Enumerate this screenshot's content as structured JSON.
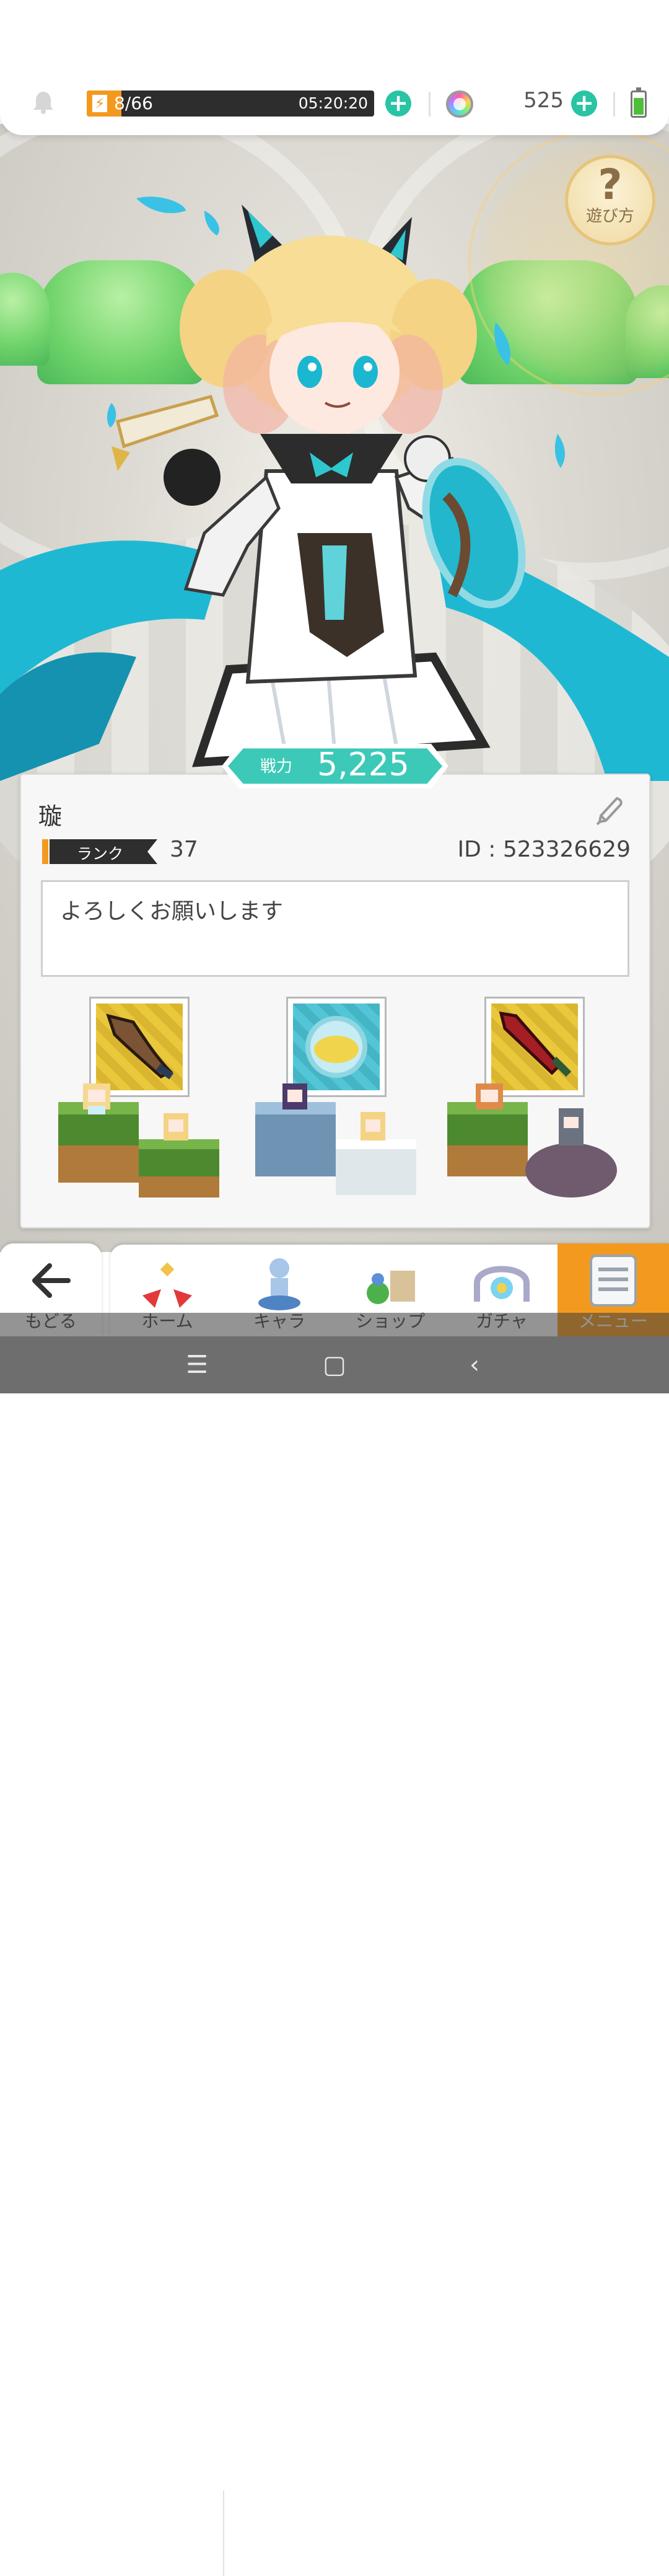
{
  "status": {
    "stamina_current": "8",
    "stamina_max": "/66",
    "stamina_fraction": 0.12,
    "stamina_timer": "05:20:20",
    "gems": "525",
    "plus": "+"
  },
  "help": {
    "label": "遊び方",
    "symbol": "?"
  },
  "power": {
    "label": "戦力",
    "value": "5,225"
  },
  "profile": {
    "name": "璇",
    "rank_label": "ランク",
    "rank_value": "37",
    "id_text": "ID : 523326629",
    "comment": "よろしくお願いします"
  },
  "nav": {
    "back": "もどる",
    "home": "ホーム",
    "chara": "キャラ",
    "shop": "ショップ",
    "gacha": "ガチャ",
    "menu": "メニュー"
  },
  "system": {
    "menu": "☰",
    "home": "▢",
    "back": "‹"
  },
  "colors": {
    "accent": "#f39a1e",
    "teal": "#28c4a4",
    "power_badge": "#3cc9b7"
  }
}
